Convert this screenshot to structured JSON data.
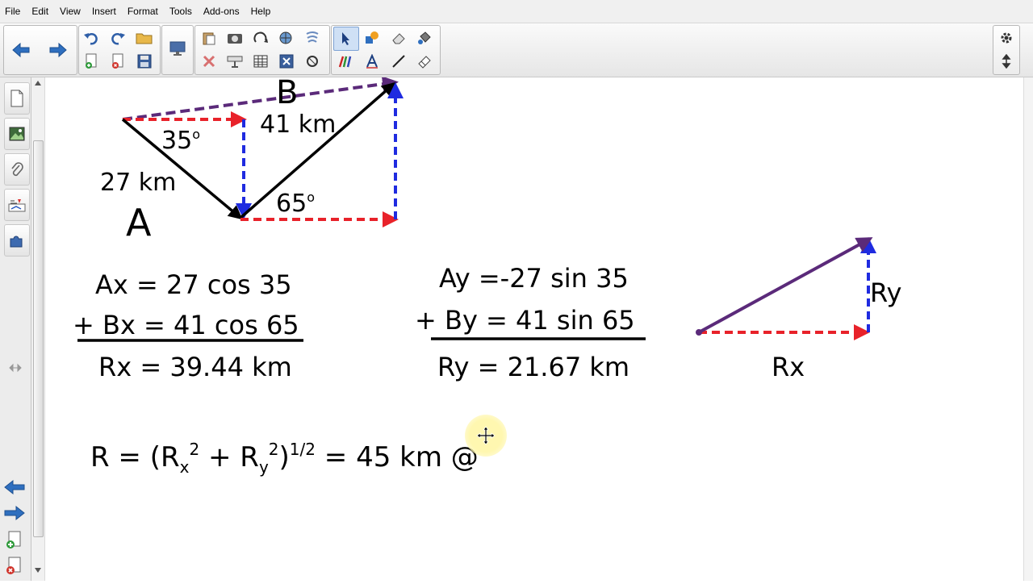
{
  "menu": [
    "File",
    "Edit",
    "View",
    "Insert",
    "Format",
    "Tools",
    "Add-ons",
    "Help"
  ],
  "colors": {
    "vector_black": "#000000",
    "resultant_purple": "#5b2a7a",
    "x_component_red": "#e8222a",
    "y_component_blue": "#1f2be0",
    "pointer_halo": "#fff7b0"
  },
  "toolbar": {
    "nav": [
      "arrow-left-icon",
      "arrow-right-icon"
    ],
    "edit": [
      "undo-icon",
      "redo-icon",
      "open-folder-icon",
      "new-page-icon",
      "delete-page-icon",
      "save-icon"
    ],
    "display": [
      "screen-shade-icon"
    ],
    "objects": [
      "paste-icon",
      "screen-capture-icon",
      "rotate-icon",
      "gallery-icon",
      "clear-ink-icon",
      "delete-icon",
      "projector-icon",
      "table-icon",
      "close-box-icon",
      "recognize-icon"
    ],
    "tools": [
      "select-icon",
      "shapes-icon",
      "eraser-icon",
      "fill-icon",
      "pens-icon",
      "text-icon",
      "line-icon",
      "magic-eraser-icon"
    ],
    "right": [
      "settings-gear-icon",
      "move-toolbar-icon"
    ]
  },
  "sidebar": [
    "page-sorter-icon",
    "gallery-icon",
    "attachments-icon",
    "properties-icon",
    "addons-icon"
  ],
  "sidebar_bottom": [
    "page-back-icon",
    "page-forward-icon",
    "add-page-icon",
    "delete-page-icon"
  ],
  "diagram": {
    "label_A": "A",
    "label_B": "B",
    "mag_A": "27 km",
    "mag_B": "41 km",
    "angle_A": "35",
    "angle_B": "65",
    "degree": "o"
  },
  "equations": {
    "ax": "Ax = 27 cos 35",
    "bx": "+ Bx = 41 cos 65",
    "rx": "Rx = 39.44 km",
    "ay": "Ay =-27 sin 35",
    "by": "+ By = 41 sin 65",
    "ry": "Ry = 21.67 km",
    "resultant": {
      "r_prefix": "R = (R",
      "x_sub": "x",
      "two": "2",
      "plus": " + R",
      "y_sub": "y",
      "close": ")",
      "half": "1/2",
      "result": " = 45 km @"
    }
  },
  "triangle": {
    "rx_label": "Rx",
    "ry_label": "Ry"
  }
}
